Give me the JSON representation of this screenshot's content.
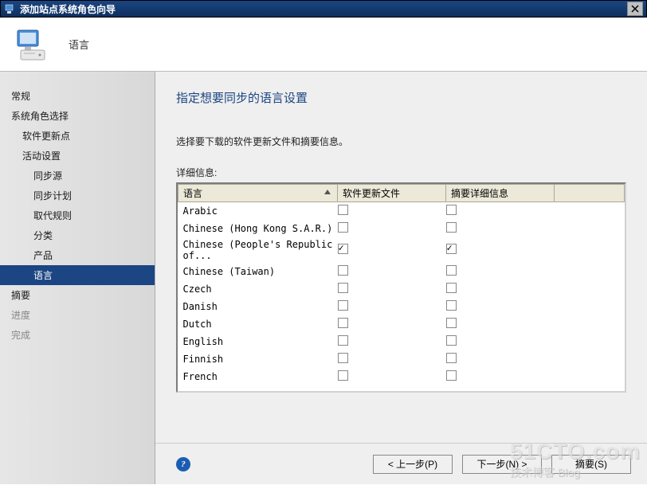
{
  "titlebar": {
    "text": "添加站点系统角色向导"
  },
  "header": {
    "title": "语言"
  },
  "sidebar": {
    "items": [
      {
        "label": "常规",
        "cls": "side-item"
      },
      {
        "label": "系统角色选择",
        "cls": "side-item"
      },
      {
        "label": "软件更新点",
        "cls": "side-item sub"
      },
      {
        "label": "活动设置",
        "cls": "side-item sub"
      },
      {
        "label": "同步源",
        "cls": "side-item sub2"
      },
      {
        "label": "同步计划",
        "cls": "side-item sub2"
      },
      {
        "label": "取代规则",
        "cls": "side-item sub2"
      },
      {
        "label": "分类",
        "cls": "side-item sub2"
      },
      {
        "label": "产品",
        "cls": "side-item sub2"
      },
      {
        "label": "语言",
        "cls": "side-item selected"
      },
      {
        "label": "摘要",
        "cls": "side-item"
      },
      {
        "label": "进度",
        "cls": "side-item disabled"
      },
      {
        "label": "完成",
        "cls": "side-item disabled"
      }
    ]
  },
  "content": {
    "heading": "指定想要同步的语言设置",
    "instruction": "选择要下载的软件更新文件和摘要信息。",
    "detail_label": "详细信息:",
    "columns": {
      "lang": "语言",
      "update": "软件更新文件",
      "summary": "摘要详细信息"
    },
    "rows": [
      {
        "lang": "Arabic",
        "u": false,
        "s": false
      },
      {
        "lang": "Chinese (Hong Kong S.A.R.)",
        "u": false,
        "s": false
      },
      {
        "lang": "Chinese (People's Republic of...",
        "u": true,
        "s": true
      },
      {
        "lang": "Chinese (Taiwan)",
        "u": false,
        "s": false
      },
      {
        "lang": "Czech",
        "u": false,
        "s": false
      },
      {
        "lang": "Danish",
        "u": false,
        "s": false
      },
      {
        "lang": "Dutch",
        "u": false,
        "s": false
      },
      {
        "lang": "English",
        "u": false,
        "s": false
      },
      {
        "lang": "Finnish",
        "u": false,
        "s": false
      },
      {
        "lang": "French",
        "u": false,
        "s": false
      }
    ]
  },
  "footer": {
    "prev": "< 上一步(P)",
    "next": "下一步(N) >",
    "summary": "摘要(S)"
  },
  "watermark": {
    "line1": "51CTO.com",
    "line2": "技术博客  Blog"
  }
}
